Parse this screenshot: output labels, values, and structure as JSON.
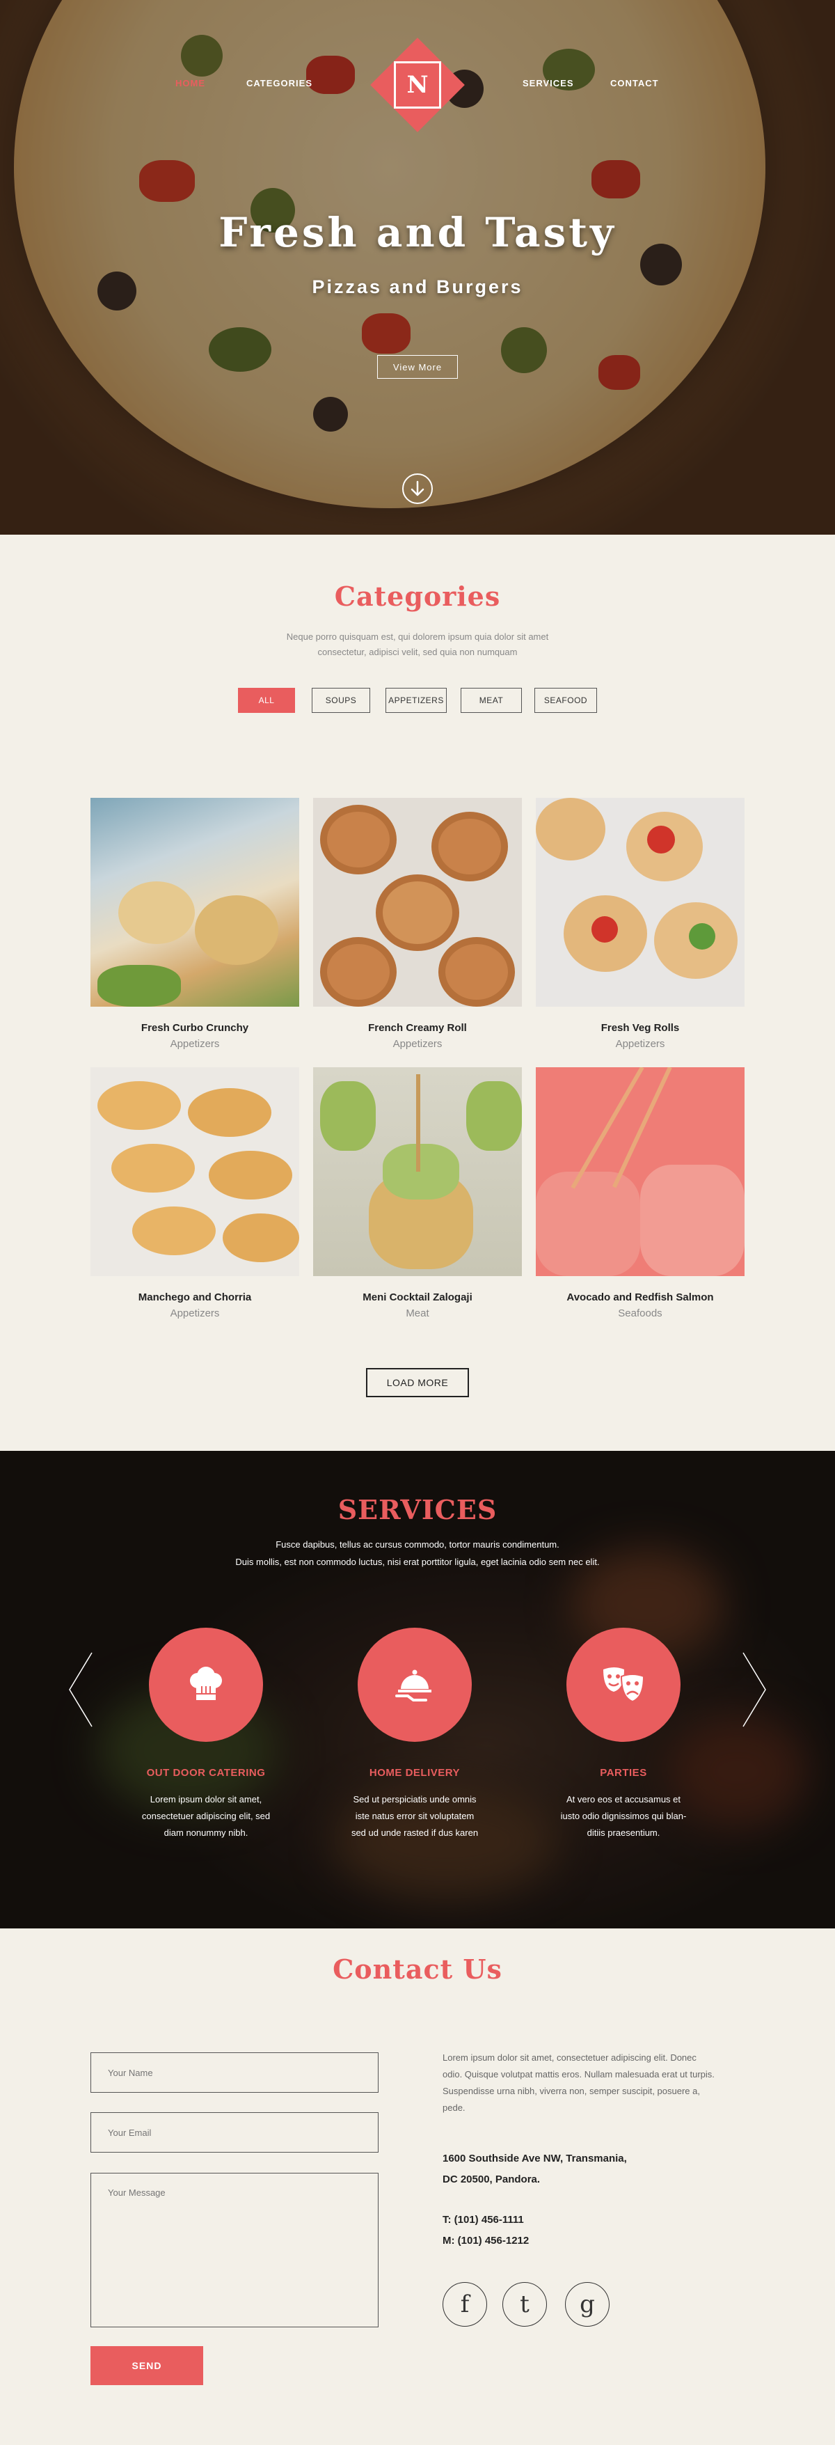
{
  "nav": {
    "left": [
      {
        "label": "HOME",
        "active": true
      },
      {
        "label": "CATEGORIES",
        "active": false
      }
    ],
    "right": [
      {
        "label": "SERVICES",
        "active": false
      },
      {
        "label": "CONTACT",
        "active": false
      }
    ],
    "logo_letter": "N"
  },
  "hero": {
    "title": "Fresh and Tasty",
    "subtitle": "Pizzas and Burgers",
    "button": "View More",
    "scroll_icon": "arrow-down-circle-icon"
  },
  "categories": {
    "title": "Categories",
    "description_line1": "Neque porro quisquam est, qui dolorem ipsum quia dolor sit amet",
    "description_line2": "consectetur, adipisci velit, sed quia non numquam",
    "filters": [
      "ALL",
      "SOUPS",
      "APPETIZERS",
      "MEAT",
      "SEAFOOD"
    ],
    "active_filter": "ALL",
    "items": [
      {
        "title": "Fresh Curbo Crunchy",
        "category": "Appetizers"
      },
      {
        "title": "French Creamy Roll",
        "category": "Appetizers"
      },
      {
        "title": "Fresh Veg Rolls",
        "category": "Appetizers"
      },
      {
        "title": "Manchego and Chorria",
        "category": "Appetizers"
      },
      {
        "title": "Meni Cocktail Zalogaji",
        "category": "Meat"
      },
      {
        "title": "Avocado and Redfish Salmon",
        "category": "Seafoods"
      }
    ],
    "load_more": "LOAD MORE"
  },
  "services": {
    "title": "SERVICES",
    "description_line1": "Fusce dapibus, tellus ac cursus commodo, tortor mauris condimentum.",
    "description_line2": "Duis mollis, est non commodo luctus, nisi erat porttitor ligula, eget lacinia odio sem nec elit.",
    "items": [
      {
        "title": "OUT DOOR CATERING",
        "icon": "chef-hat-icon",
        "line1": "Lorem ipsum dolor sit amet,",
        "line2": "consectetuer adipiscing elit, sed",
        "line3": "diam nonummy nibh."
      },
      {
        "title": "HOME DELIVERY",
        "icon": "serving-cloche-icon",
        "line1": "Sed ut perspiciatis unde omnis",
        "line2": "iste natus error sit voluptatem",
        "line3": "sed ud unde rasted if dus karen"
      },
      {
        "title": "PARTIES",
        "icon": "theater-masks-icon",
        "line1": "At vero eos et accusamus et",
        "line2": "iusto odio dignissimos qui blan-",
        "line3": "ditiis praesentium."
      }
    ]
  },
  "contact": {
    "title": "Contact Us",
    "name_placeholder": "Your Name",
    "email_placeholder": "Your Email",
    "message_placeholder": "Your Message",
    "send": "SEND",
    "about_line1": "Lorem ipsum dolor sit amet, consectetuer adipiscing elit. Donec",
    "about_line2": "odio. Quisque volutpat mattis eros. Nullam malesuada erat ut turpis.",
    "about_line3": "Suspendisse urna nibh, viverra non, semper suscipit, posuere a,",
    "about_line4": "pede.",
    "address_line1": "1600 Southside Ave NW, Transmania,",
    "address_line2": "DC 20500, Pandora.",
    "phone": "T: (101) 456-1111",
    "mobile": "M: (101) 456-1212",
    "social": [
      {
        "glyph": "f",
        "icon": "facebook-icon"
      },
      {
        "glyph": "t",
        "icon": "twitter-icon"
      },
      {
        "glyph": "g",
        "icon": "google-icon"
      }
    ]
  },
  "colors": {
    "accent": "#e95d5e",
    "background": "#f3f0e8",
    "dark": "#222222"
  }
}
